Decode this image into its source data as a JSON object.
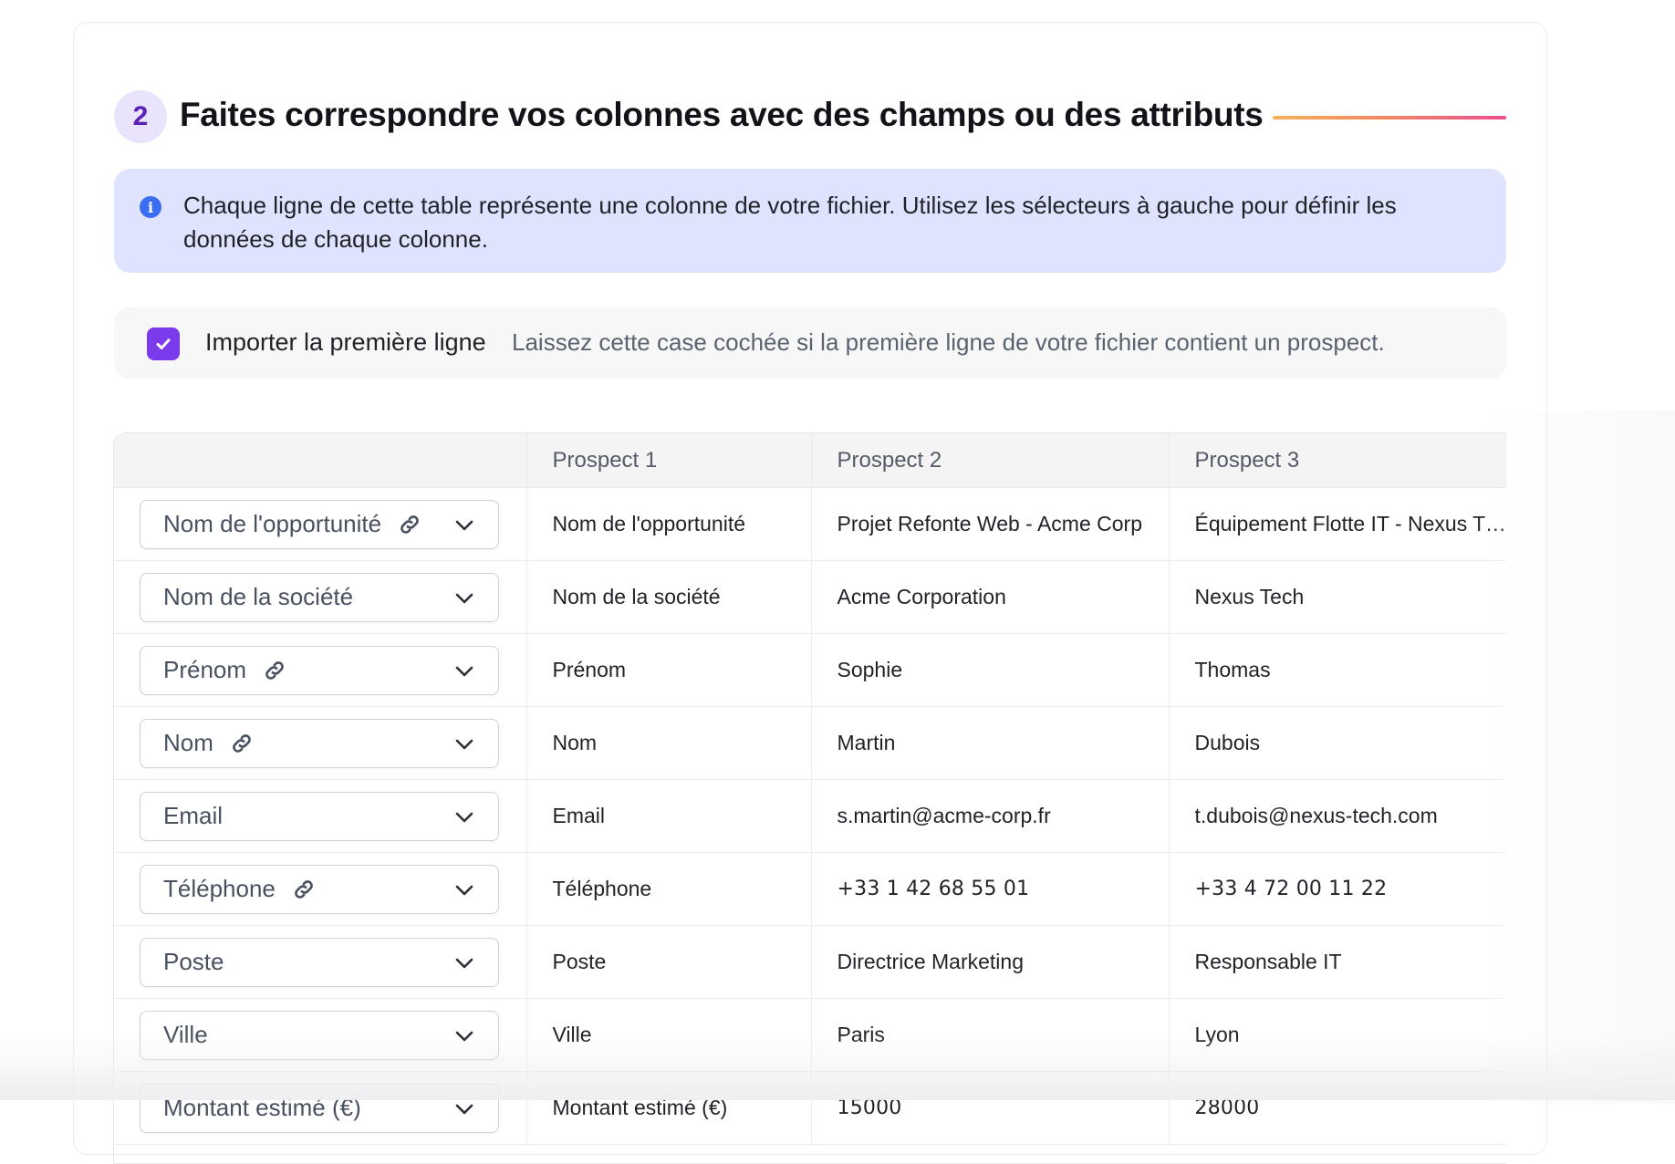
{
  "step": {
    "number": "2",
    "title": "Faites correspondre vos colonnes avec des champs ou des attributs"
  },
  "info": {
    "text": "Chaque ligne de cette table représente une colonne de votre fichier. Utilisez les sélecteurs à gauche pour définir les données de chaque colonne."
  },
  "import_first_row": {
    "checked": true,
    "label": "Importer la première ligne",
    "hint": "Laissez cette case cochée si la première ligne de votre fichier contient un prospect."
  },
  "table": {
    "headers": [
      "",
      "Prospect 1",
      "Prospect 2",
      "Prospect 3"
    ],
    "rows": [
      {
        "field": "Nom de l'opportunité",
        "linked": true,
        "p1": "Nom de l'opportunité",
        "p2": "Projet Refonte Web - Acme Corp",
        "p3": "Équipement Flotte IT - Nexus T ..."
      },
      {
        "field": "Nom de la société",
        "linked": false,
        "p1": "Nom de la société",
        "p2": "Acme Corporation",
        "p3": "Nexus Tech"
      },
      {
        "field": "Prénom",
        "linked": true,
        "p1": "Prénom",
        "p2": "Sophie",
        "p3": "Thomas"
      },
      {
        "field": "Nom",
        "linked": true,
        "p1": "Nom",
        "p2": "Martin",
        "p3": "Dubois"
      },
      {
        "field": "Email",
        "linked": false,
        "p1": "Email",
        "p2": "s.martin@acme-corp.fr",
        "p3": "t.dubois@nexus-tech.com"
      },
      {
        "field": "Téléphone",
        "linked": true,
        "p1": "Téléphone",
        "p2": "+33 1 42 68 55 01",
        "p3": "+33 4 72 00 11 22"
      },
      {
        "field": "Poste",
        "linked": false,
        "p1": "Poste",
        "p2": "Directrice Marketing",
        "p3": "Responsable IT"
      },
      {
        "field": "Ville",
        "linked": false,
        "p1": "Ville",
        "p2": "Paris",
        "p3": "Lyon"
      },
      {
        "field": "Montant estimé (€)",
        "linked": false,
        "p1": "Montant estimé (€)",
        "p2": "15000",
        "p3": "28000"
      }
    ]
  },
  "colors": {
    "accent": "#7c3aed",
    "info_bg": "#dfe3fe",
    "info_icon": "#3b6df0",
    "step_badge_bg": "#e9e4fb"
  },
  "icons": [
    "info-icon",
    "check-icon",
    "link-icon",
    "chevron-down-icon"
  ]
}
